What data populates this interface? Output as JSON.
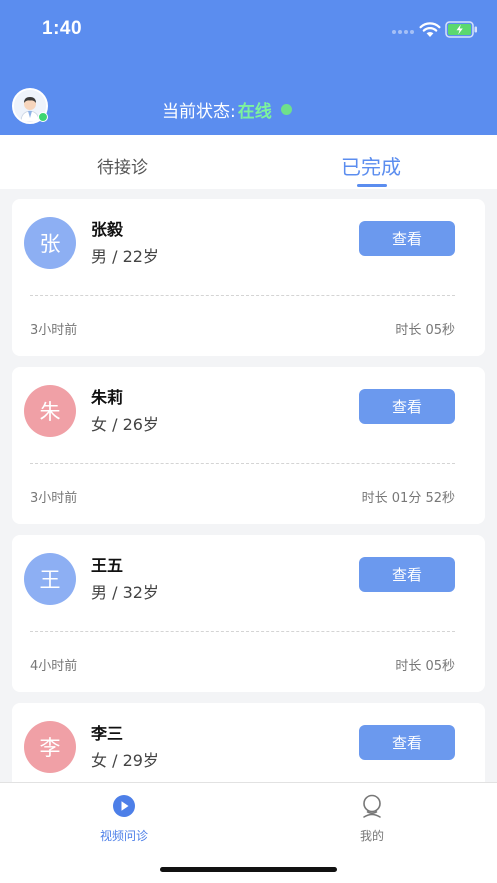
{
  "status_bar": {
    "time": "1:40"
  },
  "header": {
    "status_label": "当前状态:",
    "status_value": "在线",
    "colors": {
      "header_bg": "#5b8def",
      "online": "#6ee08b"
    }
  },
  "tabs": [
    {
      "label": "待接诊",
      "active": false
    },
    {
      "label": "已完成",
      "active": true
    }
  ],
  "records": [
    {
      "initial": "张",
      "name": "张毅",
      "info": "男 / 22岁",
      "button": "查看",
      "time_ago": "3小时前",
      "duration": "时长 05秒",
      "avatar_color": "blue"
    },
    {
      "initial": "朱",
      "name": "朱莉",
      "info": "女 / 26岁",
      "button": "查看",
      "time_ago": "3小时前",
      "duration": "时长 01分 52秒",
      "avatar_color": "pink"
    },
    {
      "initial": "王",
      "name": "王五",
      "info": "男 / 32岁",
      "button": "查看",
      "time_ago": "4小时前",
      "duration": "时长 05秒",
      "avatar_color": "blue"
    },
    {
      "initial": "李",
      "name": "李三",
      "info": "女 / 29岁",
      "button": "查看",
      "time_ago": "",
      "duration": "",
      "avatar_color": "pink"
    }
  ],
  "tabbar": [
    {
      "label": "视频问诊",
      "icon": "video-play-icon",
      "active": true
    },
    {
      "label": "我的",
      "icon": "user-icon",
      "active": false
    }
  ]
}
